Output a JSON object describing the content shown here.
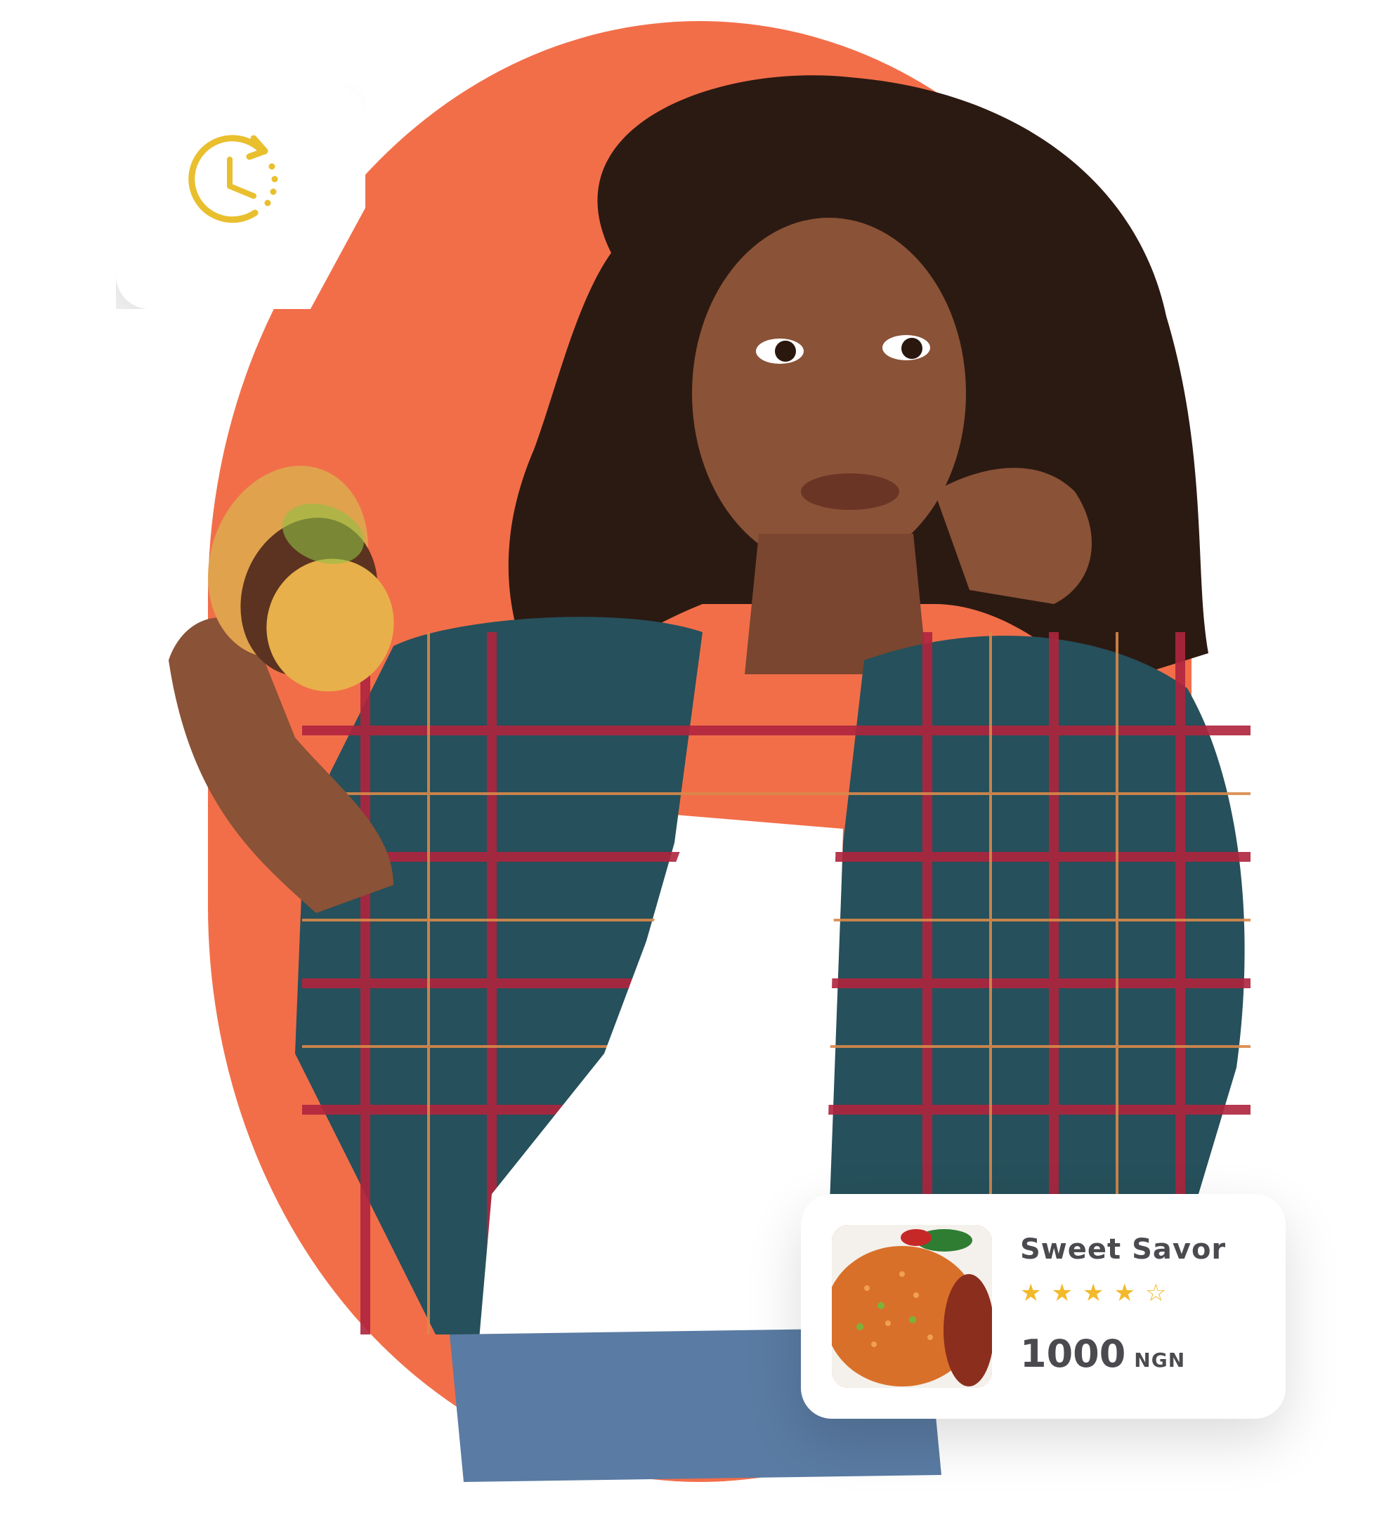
{
  "colors": {
    "backdrop": "#F26E49",
    "card": "#FFFFFF",
    "clock_icon": "#E9BF2E",
    "star": "#F2B92B",
    "text": "#4A4A4F"
  },
  "clock_badge": {
    "icon": "clock-history-icon"
  },
  "product_card": {
    "name": "Sweet Savor",
    "rating": 4,
    "rating_max": 5,
    "price_amount": "1000",
    "price_currency": "NGN",
    "thumbnail": "jollof-rice-with-chicken-image"
  },
  "hero": {
    "image": "woman-eating-burger-photo"
  }
}
